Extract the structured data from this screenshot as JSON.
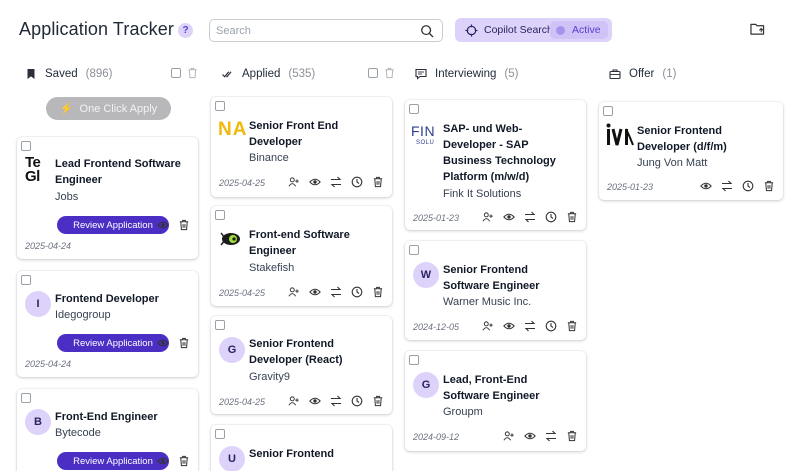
{
  "header": {
    "title": "Application Tracker",
    "help": "?",
    "search_placeholder": "Search",
    "copilot_label": "Copilot Search",
    "copilot_status": "Active"
  },
  "columns": [
    {
      "name": "Saved",
      "count": "(896)"
    },
    {
      "name": "Applied",
      "count": "(535)"
    },
    {
      "name": "Interviewing",
      "count": "(5)"
    },
    {
      "name": "Offer",
      "count": "(1)"
    }
  ],
  "one_click_label": "One Click Apply",
  "review_label": "Review Application",
  "saved": [
    {
      "title1": "Lead Frontend Software",
      "title2": "Engineer",
      "company": "Jobs",
      "date": "2025-04-24",
      "logo": "Te Gl"
    },
    {
      "title1": "Frontend Developer",
      "title2": "",
      "company": "Idegogroup",
      "date": "2025-04-24",
      "avatar": "I"
    },
    {
      "title1": "Front-End Engineer",
      "title2": "",
      "company": "Bytecode",
      "date": "",
      "avatar": "B"
    }
  ],
  "applied": [
    {
      "title1": "Senior Front End",
      "title2": "Developer",
      "company": "Binance",
      "date": "2025-04-25",
      "logo": "NA"
    },
    {
      "title1": "Front-end Software",
      "title2": "Engineer",
      "company": "Stakefish",
      "date": "2025-04-25"
    },
    {
      "title1": "Senior Frontend",
      "title2": "Developer (React)",
      "company": "Gravity9",
      "date": "2025-04-25",
      "avatar": "G"
    },
    {
      "title1": "Senior Frontend",
      "avatar": "U"
    }
  ],
  "interviewing": [
    {
      "title1": "SAP- und Web-",
      "title2": "Developer - SAP",
      "title3": "Business Technology",
      "title4": "Platform (m/w/d)",
      "company": "Fink It Solutions",
      "date": "2025-01-23",
      "logo": "FIN",
      "logo_sub": "SOLU"
    },
    {
      "title1": "Senior Frontend",
      "title2": "Software Engineer",
      "company": "Warner Music Inc.",
      "date": "2024-12-05",
      "avatar": "W"
    },
    {
      "title1": "Lead, Front-End",
      "title2": "Software Engineer",
      "company": "Groupm",
      "date": "2024-09-12",
      "avatar": "G"
    }
  ],
  "offer": [
    {
      "title1": "Senior Frontend",
      "title2": "Developer (d/f/m)",
      "company": "Jung Von Matt",
      "date": "2025-01-23",
      "logo": "jvm"
    }
  ],
  "colors": {
    "accent": "#4b2fc4",
    "lavender": "#ddd3fa",
    "binance": "#f0b90b"
  }
}
